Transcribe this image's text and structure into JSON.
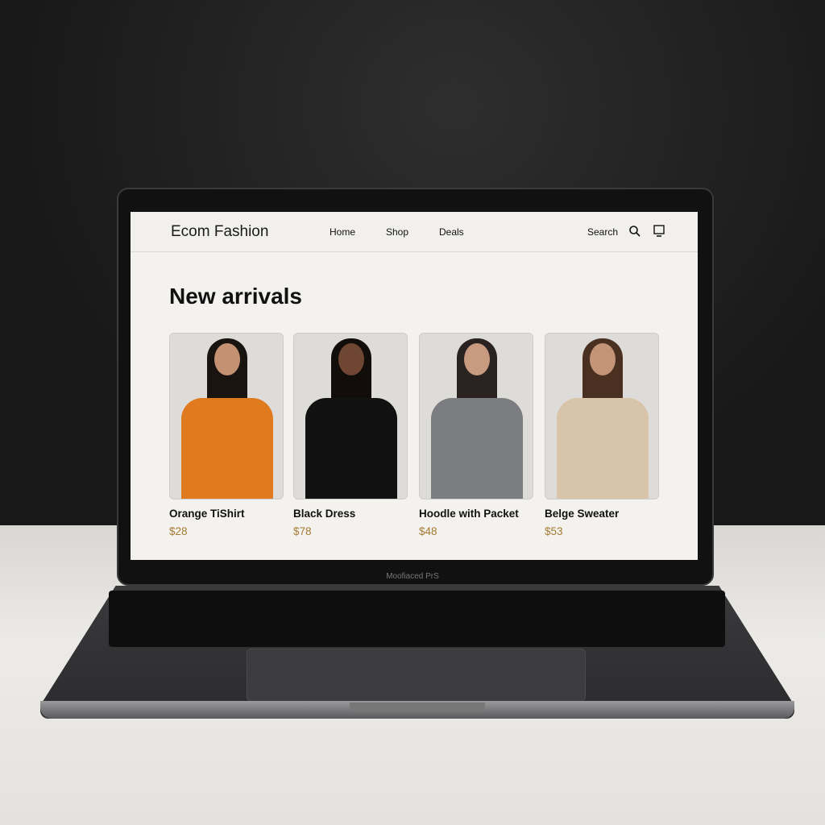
{
  "header": {
    "brand": "Ecom Fashion",
    "nav": [
      "Home",
      "Shop",
      "Deals"
    ],
    "search_label": "Search"
  },
  "main": {
    "title": "New arrivals",
    "products": [
      {
        "name": "Orange TiShirt",
        "price": "$28",
        "color": "#e07a1f",
        "hair": "#1a1410",
        "skin": "#c49273"
      },
      {
        "name": "Black Dress",
        "price": "$78",
        "color": "#111111",
        "hair": "#120d0a",
        "skin": "#6e4632"
      },
      {
        "name": "Hoodle with Packet",
        "price": "$48",
        "color": "#7c7d80",
        "hair": "#2a2220",
        "skin": "#c89a80"
      },
      {
        "name": "Belge Sweater",
        "price": "$53",
        "color": "#d8c4a8",
        "hair": "#4a3020",
        "skin": "#c49478"
      }
    ]
  },
  "device": {
    "label": "Moofiaced PrS"
  }
}
